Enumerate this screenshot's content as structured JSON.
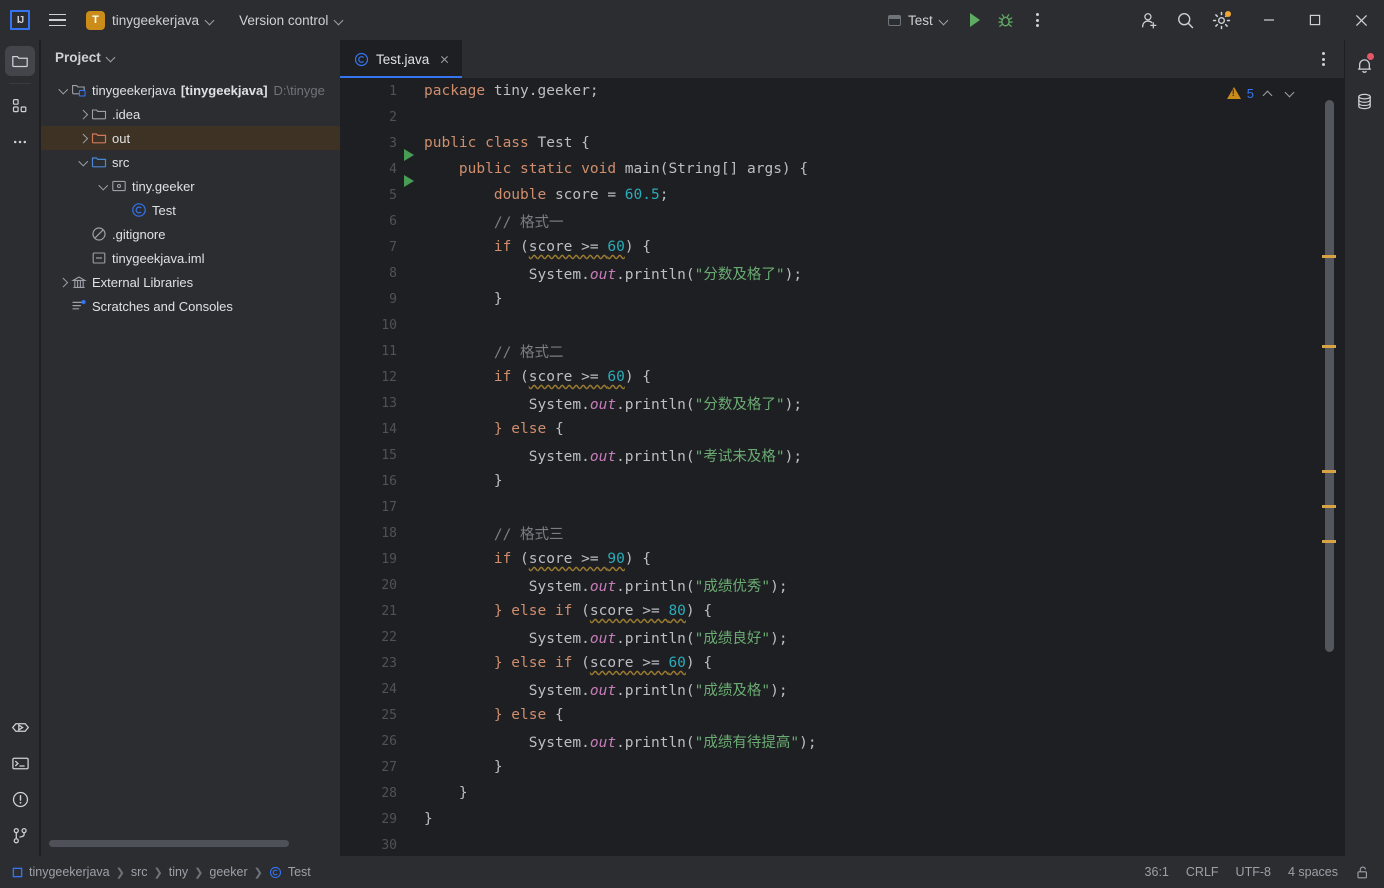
{
  "titlebar": {
    "logo_alt": "IJ",
    "project_badge": "T",
    "project_name": "tinygeekerjava",
    "version_control": "Version control",
    "run_config": "Test",
    "run_tooltip": "Run",
    "debug_tooltip": "Debug",
    "more_tooltip": "More Actions"
  },
  "left_rail": {
    "items": [
      {
        "name": "project-tool-window",
        "icon": "folder-icon",
        "active": true
      },
      {
        "name": "structure-tool-window",
        "icon": "structure-icon",
        "active": false
      },
      {
        "name": "more-tool-windows",
        "icon": "more-icon",
        "active": false
      }
    ],
    "bottom_items": [
      {
        "name": "run-tool-window",
        "icon": "run-icon"
      },
      {
        "name": "terminal-tool-window",
        "icon": "terminal-icon"
      },
      {
        "name": "problems-tool-window",
        "icon": "problems-icon"
      },
      {
        "name": "version-control-tool-window",
        "icon": "branch-icon"
      }
    ]
  },
  "project_panel": {
    "title": "Project",
    "tree": [
      {
        "depth": 0,
        "arrow": "down",
        "icon": "module-icon",
        "label": "tinygeekerjava",
        "bracket": "[tinygeekjava]",
        "path": "D:\\tinyge",
        "selected": false
      },
      {
        "depth": 1,
        "arrow": "right",
        "icon": "folder-icon",
        "label": ".idea",
        "selected": false
      },
      {
        "depth": 1,
        "arrow": "right",
        "icon": "folder-out-icon",
        "label": "out",
        "selected": true
      },
      {
        "depth": 1,
        "arrow": "down",
        "icon": "folder-src-icon",
        "label": "src",
        "selected": false
      },
      {
        "depth": 2,
        "arrow": "down",
        "icon": "package-icon",
        "label": "tiny.geeker",
        "selected": false
      },
      {
        "depth": 3,
        "arrow": "none",
        "icon": "class-icon",
        "label": "Test",
        "selected": false
      },
      {
        "depth": 1,
        "arrow": "none",
        "icon": "gitignore-icon",
        "label": ".gitignore",
        "selected": false
      },
      {
        "depth": 1,
        "arrow": "none",
        "icon": "iml-icon",
        "label": "tinygeekjava.iml",
        "selected": false
      },
      {
        "depth": 0,
        "arrow": "right",
        "icon": "library-icon",
        "label": "External Libraries",
        "selected": false
      },
      {
        "depth": 0,
        "arrow": "none",
        "icon": "scratches-icon",
        "label": "Scratches and Consoles",
        "selected": false
      }
    ]
  },
  "editor": {
    "tab": {
      "label": "Test.java",
      "icon": "class-icon"
    },
    "inspection": {
      "warning_count": "5",
      "icon": "warning-triangle-icon"
    },
    "first_line": 1,
    "total_visible_lines": 30,
    "run_arrow_lines": [
      3,
      4
    ],
    "marker_positions": [
      215,
      305,
      430,
      465,
      500
    ],
    "lines": [
      {
        "n": 1,
        "tokens": [
          {
            "t": "package ",
            "c": "kw"
          },
          {
            "t": "tiny.geeker;",
            "c": "ident"
          }
        ]
      },
      {
        "n": 2,
        "tokens": []
      },
      {
        "n": 3,
        "tokens": [
          {
            "t": "public class ",
            "c": "kw"
          },
          {
            "t": "Test {",
            "c": "typ"
          }
        ]
      },
      {
        "n": 4,
        "tokens": [
          {
            "t": "    public static void ",
            "c": "kw"
          },
          {
            "t": "main",
            "c": "mn"
          },
          {
            "t": "(String[] args) {",
            "c": "ident"
          }
        ]
      },
      {
        "n": 5,
        "tokens": [
          {
            "t": "        double ",
            "c": "kw"
          },
          {
            "t": "score = ",
            "c": "ident"
          },
          {
            "t": "60.5",
            "c": "num"
          },
          {
            "t": ";",
            "c": "ident"
          }
        ]
      },
      {
        "n": 6,
        "tokens": [
          {
            "t": "        // 格式一",
            "c": "cmt"
          }
        ]
      },
      {
        "n": 7,
        "tokens": [
          {
            "t": "        if ",
            "c": "kw"
          },
          {
            "t": "(",
            "c": "ident"
          },
          {
            "t": "score >= ",
            "c": "warnu"
          },
          {
            "t": "60",
            "c": "numu"
          },
          {
            "t": ") {",
            "c": "ident"
          }
        ]
      },
      {
        "n": 8,
        "tokens": [
          {
            "t": "            System.",
            "c": "ident"
          },
          {
            "t": "out",
            "c": "fld"
          },
          {
            "t": ".println(",
            "c": "ident"
          },
          {
            "t": "\"分数及格了\"",
            "c": "str"
          },
          {
            "t": ");",
            "c": "ident"
          }
        ]
      },
      {
        "n": 9,
        "tokens": [
          {
            "t": "        }",
            "c": "ident"
          }
        ]
      },
      {
        "n": 10,
        "tokens": []
      },
      {
        "n": 11,
        "tokens": [
          {
            "t": "        // 格式二",
            "c": "cmt"
          }
        ]
      },
      {
        "n": 12,
        "tokens": [
          {
            "t": "        if ",
            "c": "kw"
          },
          {
            "t": "(",
            "c": "ident"
          },
          {
            "t": "score >= ",
            "c": "warnu"
          },
          {
            "t": "60",
            "c": "numu"
          },
          {
            "t": ") {",
            "c": "ident"
          }
        ]
      },
      {
        "n": 13,
        "tokens": [
          {
            "t": "            System.",
            "c": "ident"
          },
          {
            "t": "out",
            "c": "fld"
          },
          {
            "t": ".println(",
            "c": "ident"
          },
          {
            "t": "\"分数及格了\"",
            "c": "str"
          },
          {
            "t": ");",
            "c": "ident"
          }
        ]
      },
      {
        "n": 14,
        "tokens": [
          {
            "t": "        } else ",
            "c": "kw"
          },
          {
            "t": "{",
            "c": "ident"
          }
        ]
      },
      {
        "n": 15,
        "tokens": [
          {
            "t": "            System.",
            "c": "ident"
          },
          {
            "t": "out",
            "c": "fld"
          },
          {
            "t": ".println(",
            "c": "ident"
          },
          {
            "t": "\"考试未及格\"",
            "c": "str"
          },
          {
            "t": ");",
            "c": "ident"
          }
        ]
      },
      {
        "n": 16,
        "tokens": [
          {
            "t": "        }",
            "c": "ident"
          }
        ]
      },
      {
        "n": 17,
        "tokens": []
      },
      {
        "n": 18,
        "tokens": [
          {
            "t": "        // 格式三",
            "c": "cmt"
          }
        ]
      },
      {
        "n": 19,
        "tokens": [
          {
            "t": "        if ",
            "c": "kw"
          },
          {
            "t": "(",
            "c": "ident"
          },
          {
            "t": "score >= ",
            "c": "warnu"
          },
          {
            "t": "90",
            "c": "numu"
          },
          {
            "t": ") {",
            "c": "ident"
          }
        ]
      },
      {
        "n": 20,
        "tokens": [
          {
            "t": "            System.",
            "c": "ident"
          },
          {
            "t": "out",
            "c": "fld"
          },
          {
            "t": ".println(",
            "c": "ident"
          },
          {
            "t": "\"成绩优秀\"",
            "c": "str"
          },
          {
            "t": ");",
            "c": "ident"
          }
        ]
      },
      {
        "n": 21,
        "tokens": [
          {
            "t": "        } else if ",
            "c": "kw"
          },
          {
            "t": "(",
            "c": "ident"
          },
          {
            "t": "score >= ",
            "c": "warnu"
          },
          {
            "t": "80",
            "c": "numu"
          },
          {
            "t": ") {",
            "c": "ident"
          }
        ]
      },
      {
        "n": 22,
        "tokens": [
          {
            "t": "            System.",
            "c": "ident"
          },
          {
            "t": "out",
            "c": "fld"
          },
          {
            "t": ".println(",
            "c": "ident"
          },
          {
            "t": "\"成绩良好\"",
            "c": "str"
          },
          {
            "t": ");",
            "c": "ident"
          }
        ]
      },
      {
        "n": 23,
        "tokens": [
          {
            "t": "        } else if ",
            "c": "kw"
          },
          {
            "t": "(",
            "c": "ident"
          },
          {
            "t": "score >= ",
            "c": "warnu"
          },
          {
            "t": "60",
            "c": "numu"
          },
          {
            "t": ") {",
            "c": "ident"
          }
        ]
      },
      {
        "n": 24,
        "tokens": [
          {
            "t": "            System.",
            "c": "ident"
          },
          {
            "t": "out",
            "c": "fld"
          },
          {
            "t": ".println(",
            "c": "ident"
          },
          {
            "t": "\"成绩及格\"",
            "c": "str"
          },
          {
            "t": ");",
            "c": "ident"
          }
        ]
      },
      {
        "n": 25,
        "tokens": [
          {
            "t": "        } else ",
            "c": "kw"
          },
          {
            "t": "{",
            "c": "ident"
          }
        ]
      },
      {
        "n": 26,
        "tokens": [
          {
            "t": "            System.",
            "c": "ident"
          },
          {
            "t": "out",
            "c": "fld"
          },
          {
            "t": ".println(",
            "c": "ident"
          },
          {
            "t": "\"成绩有待提高\"",
            "c": "str"
          },
          {
            "t": ");",
            "c": "ident"
          }
        ]
      },
      {
        "n": 27,
        "tokens": [
          {
            "t": "        }",
            "c": "ident"
          }
        ]
      },
      {
        "n": 28,
        "tokens": [
          {
            "t": "    }",
            "c": "ident"
          }
        ]
      },
      {
        "n": 29,
        "tokens": [
          {
            "t": "}",
            "c": "ident"
          }
        ]
      },
      {
        "n": 30,
        "tokens": []
      }
    ]
  },
  "right_rail": {
    "items": [
      {
        "name": "notifications",
        "icon": "bell-icon",
        "badge": true
      },
      {
        "name": "database",
        "icon": "database-icon",
        "badge": false
      }
    ]
  },
  "statusbar": {
    "breadcrumbs": [
      "tinygeekerjava",
      "src",
      "tiny",
      "geeker",
      "Test"
    ],
    "caret_position": "36:1",
    "line_separator": "CRLF",
    "encoding": "UTF-8",
    "indent": "4 spaces",
    "lock_icon": "unlocked-icon"
  },
  "colors": {
    "bg_editor": "#1e1f22",
    "bg_panel": "#2b2d30",
    "accent_blue": "#3574f0",
    "keyword": "#cf8e6d",
    "string": "#6aab73",
    "number": "#2aacb8",
    "comment": "#7a7e85",
    "field": "#c77dbb",
    "warning": "#cc8c19",
    "selected_row": "#3d3223"
  }
}
